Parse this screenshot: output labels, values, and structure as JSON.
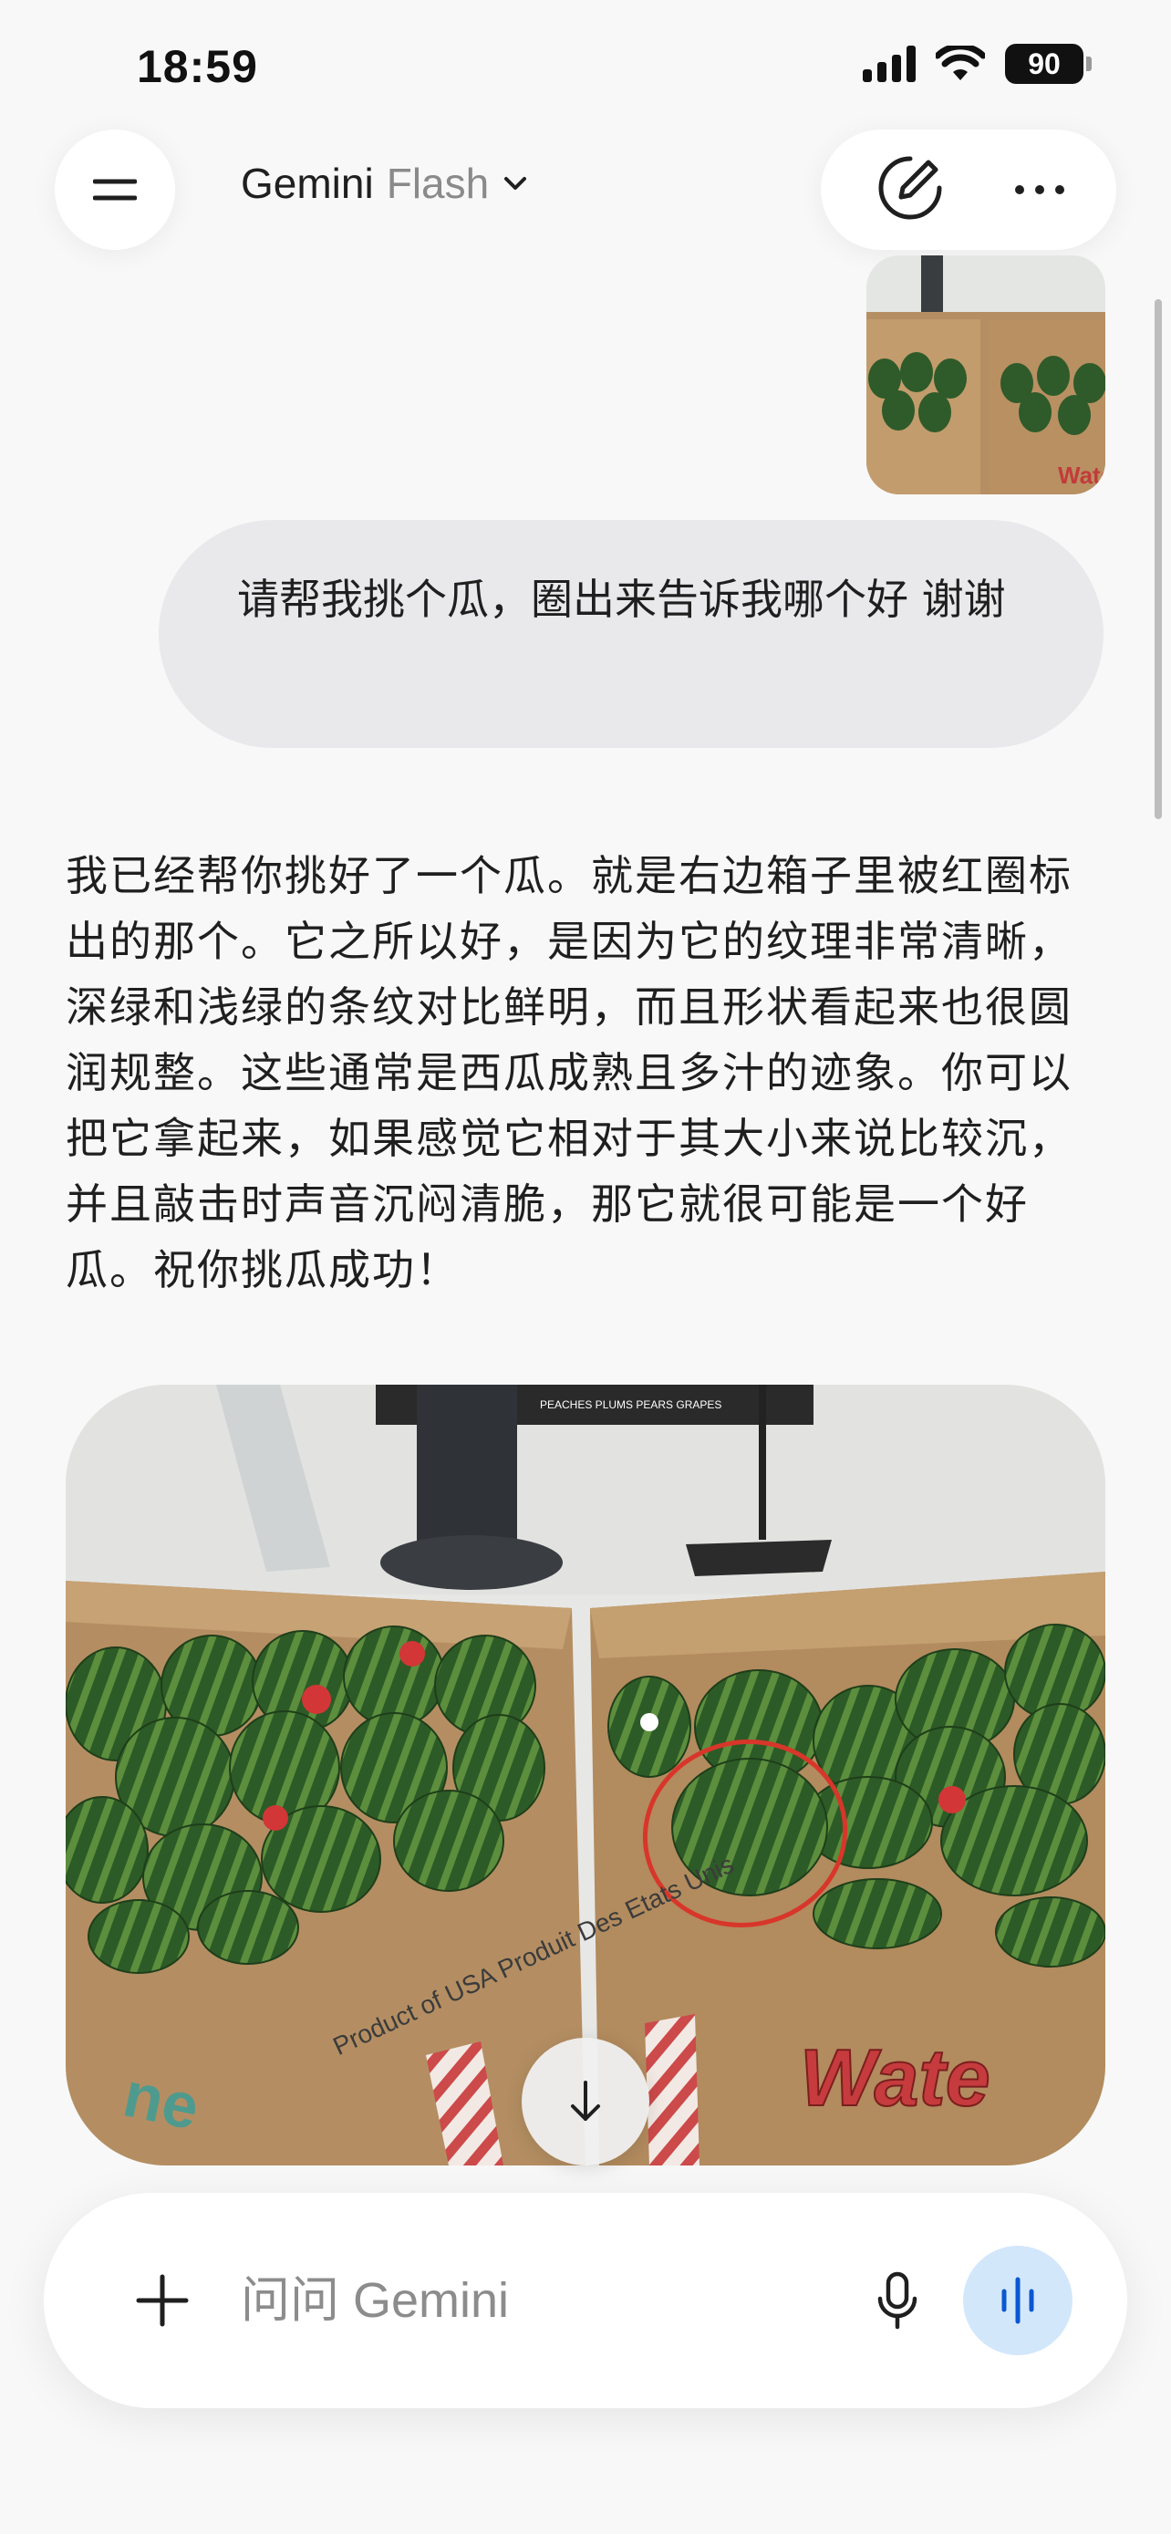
{
  "status": {
    "time": "18:59",
    "battery": "90"
  },
  "header": {
    "title": "Gemini",
    "model": "Flash"
  },
  "conversation": {
    "user_prompt": "请帮我挑个瓜，圈出来告诉我哪个好 谢谢",
    "response": "我已经帮你挑好了一个瓜。就是右边箱子里被红圈标出的那个。它之所以好，是因为它的纹理非常清晰，深绿和浅绿的条纹对比鲜明，而且形状看起来也很圆润规整。这些通常是西瓜成熟且多汁的迹象。你可以把它拿起来，如果感觉它相对于其大小来说比较沉，并且敲击时声音沉闷清脆，那它就很可能是一个好瓜。祝你挑瓜成功！"
  },
  "image_text": {
    "box_label": "Product of USA\nProduit Des Etats Unis",
    "box_brand_right": "Wate",
    "box_brand_left": "ne",
    "store_sign": "PEACHES PLUMS PEARS GRAPES"
  },
  "input": {
    "placeholder": "问问 Gemini"
  },
  "icons": {
    "menu": "menu-icon",
    "chevron": "chevron-down-icon",
    "new_chat": "edit-pen-icon",
    "more": "more-dots-icon",
    "scroll": "arrow-down-icon",
    "add": "plus-icon",
    "mic": "mic-icon",
    "live": "live-waveform-icon"
  },
  "colors": {
    "live_button": "#d3e7fb",
    "bubble": "#e9e9eb",
    "highlight_circle": "#d8362a"
  }
}
